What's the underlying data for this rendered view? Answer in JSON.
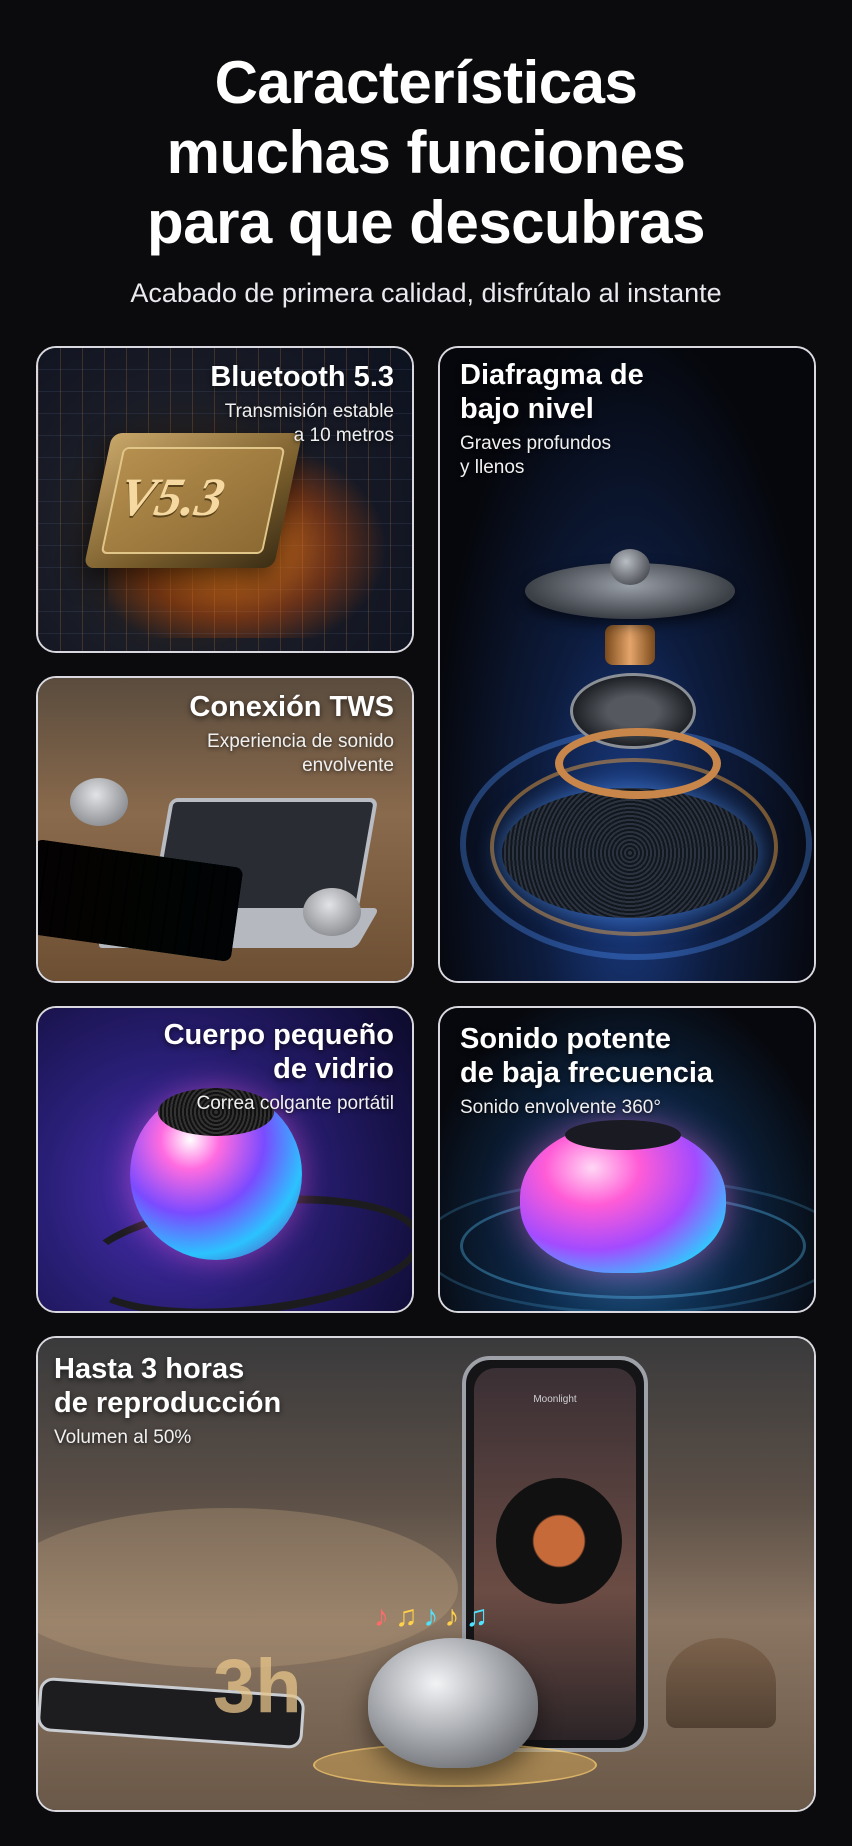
{
  "hero": {
    "title_lines": [
      "Características",
      "muchas funciones",
      "para que descubras"
    ],
    "subtitle": "Acabado de primera calidad, disfrútalo al instante"
  },
  "cards": [
    {
      "title_lines": [
        "Bluetooth 5.3"
      ],
      "desc_lines": [
        "Transmisión estable",
        "a 10 metros"
      ],
      "badge": "V5.3"
    },
    {
      "title_lines": [
        "Diafragma de",
        "bajo nivel"
      ],
      "desc_lines": [
        "Graves profundos",
        "y llenos"
      ]
    },
    {
      "title_lines": [
        "Conexión TWS"
      ],
      "desc_lines": [
        "Experiencia de sonido",
        "envolvente"
      ]
    },
    {
      "title_lines": [
        "Cuerpo pequeño",
        "de vidrio"
      ],
      "desc_lines": [
        "Correa colgante portátil"
      ]
    },
    {
      "title_lines": [
        "Sonido potente",
        "de baja frecuencia"
      ],
      "desc_lines": [
        "Sonido envolvente 360°"
      ]
    },
    {
      "title_lines": [
        "Hasta 3 horas",
        "de reproducción"
      ],
      "desc_lines": [
        "Volumen al 50%"
      ],
      "badge": "3h",
      "phone_text": "Moonlight"
    }
  ],
  "icons": {
    "notes": [
      "music-note-icon",
      "music-note-icon",
      "music-note-icon"
    ]
  }
}
